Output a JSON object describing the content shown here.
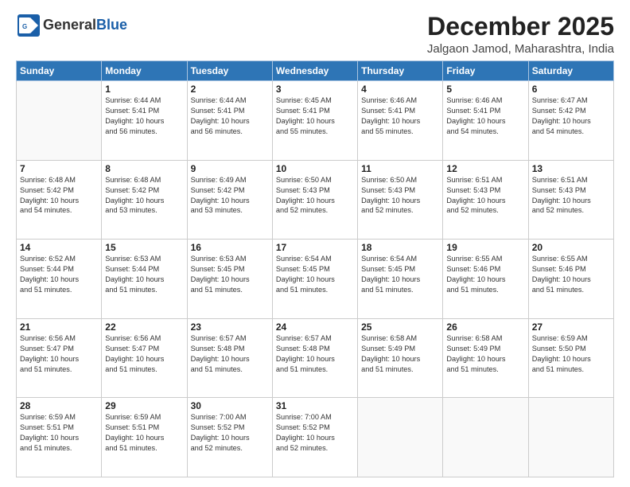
{
  "header": {
    "logo_general": "General",
    "logo_blue": "Blue",
    "month": "December 2025",
    "location": "Jalgaon Jamod, Maharashtra, India"
  },
  "weekdays": [
    "Sunday",
    "Monday",
    "Tuesday",
    "Wednesday",
    "Thursday",
    "Friday",
    "Saturday"
  ],
  "weeks": [
    [
      {
        "day": "",
        "info": ""
      },
      {
        "day": "1",
        "info": "Sunrise: 6:44 AM\nSunset: 5:41 PM\nDaylight: 10 hours\nand 56 minutes."
      },
      {
        "day": "2",
        "info": "Sunrise: 6:44 AM\nSunset: 5:41 PM\nDaylight: 10 hours\nand 56 minutes."
      },
      {
        "day": "3",
        "info": "Sunrise: 6:45 AM\nSunset: 5:41 PM\nDaylight: 10 hours\nand 55 minutes."
      },
      {
        "day": "4",
        "info": "Sunrise: 6:46 AM\nSunset: 5:41 PM\nDaylight: 10 hours\nand 55 minutes."
      },
      {
        "day": "5",
        "info": "Sunrise: 6:46 AM\nSunset: 5:41 PM\nDaylight: 10 hours\nand 54 minutes."
      },
      {
        "day": "6",
        "info": "Sunrise: 6:47 AM\nSunset: 5:42 PM\nDaylight: 10 hours\nand 54 minutes."
      }
    ],
    [
      {
        "day": "7",
        "info": "Sunrise: 6:48 AM\nSunset: 5:42 PM\nDaylight: 10 hours\nand 54 minutes."
      },
      {
        "day": "8",
        "info": "Sunrise: 6:48 AM\nSunset: 5:42 PM\nDaylight: 10 hours\nand 53 minutes."
      },
      {
        "day": "9",
        "info": "Sunrise: 6:49 AM\nSunset: 5:42 PM\nDaylight: 10 hours\nand 53 minutes."
      },
      {
        "day": "10",
        "info": "Sunrise: 6:50 AM\nSunset: 5:43 PM\nDaylight: 10 hours\nand 52 minutes."
      },
      {
        "day": "11",
        "info": "Sunrise: 6:50 AM\nSunset: 5:43 PM\nDaylight: 10 hours\nand 52 minutes."
      },
      {
        "day": "12",
        "info": "Sunrise: 6:51 AM\nSunset: 5:43 PM\nDaylight: 10 hours\nand 52 minutes."
      },
      {
        "day": "13",
        "info": "Sunrise: 6:51 AM\nSunset: 5:43 PM\nDaylight: 10 hours\nand 52 minutes."
      }
    ],
    [
      {
        "day": "14",
        "info": "Sunrise: 6:52 AM\nSunset: 5:44 PM\nDaylight: 10 hours\nand 51 minutes."
      },
      {
        "day": "15",
        "info": "Sunrise: 6:53 AM\nSunset: 5:44 PM\nDaylight: 10 hours\nand 51 minutes."
      },
      {
        "day": "16",
        "info": "Sunrise: 6:53 AM\nSunset: 5:45 PM\nDaylight: 10 hours\nand 51 minutes."
      },
      {
        "day": "17",
        "info": "Sunrise: 6:54 AM\nSunset: 5:45 PM\nDaylight: 10 hours\nand 51 minutes."
      },
      {
        "day": "18",
        "info": "Sunrise: 6:54 AM\nSunset: 5:45 PM\nDaylight: 10 hours\nand 51 minutes."
      },
      {
        "day": "19",
        "info": "Sunrise: 6:55 AM\nSunset: 5:46 PM\nDaylight: 10 hours\nand 51 minutes."
      },
      {
        "day": "20",
        "info": "Sunrise: 6:55 AM\nSunset: 5:46 PM\nDaylight: 10 hours\nand 51 minutes."
      }
    ],
    [
      {
        "day": "21",
        "info": "Sunrise: 6:56 AM\nSunset: 5:47 PM\nDaylight: 10 hours\nand 51 minutes."
      },
      {
        "day": "22",
        "info": "Sunrise: 6:56 AM\nSunset: 5:47 PM\nDaylight: 10 hours\nand 51 minutes."
      },
      {
        "day": "23",
        "info": "Sunrise: 6:57 AM\nSunset: 5:48 PM\nDaylight: 10 hours\nand 51 minutes."
      },
      {
        "day": "24",
        "info": "Sunrise: 6:57 AM\nSunset: 5:48 PM\nDaylight: 10 hours\nand 51 minutes."
      },
      {
        "day": "25",
        "info": "Sunrise: 6:58 AM\nSunset: 5:49 PM\nDaylight: 10 hours\nand 51 minutes."
      },
      {
        "day": "26",
        "info": "Sunrise: 6:58 AM\nSunset: 5:49 PM\nDaylight: 10 hours\nand 51 minutes."
      },
      {
        "day": "27",
        "info": "Sunrise: 6:59 AM\nSunset: 5:50 PM\nDaylight: 10 hours\nand 51 minutes."
      }
    ],
    [
      {
        "day": "28",
        "info": "Sunrise: 6:59 AM\nSunset: 5:51 PM\nDaylight: 10 hours\nand 51 minutes."
      },
      {
        "day": "29",
        "info": "Sunrise: 6:59 AM\nSunset: 5:51 PM\nDaylight: 10 hours\nand 51 minutes."
      },
      {
        "day": "30",
        "info": "Sunrise: 7:00 AM\nSunset: 5:52 PM\nDaylight: 10 hours\nand 52 minutes."
      },
      {
        "day": "31",
        "info": "Sunrise: 7:00 AM\nSunset: 5:52 PM\nDaylight: 10 hours\nand 52 minutes."
      },
      {
        "day": "",
        "info": ""
      },
      {
        "day": "",
        "info": ""
      },
      {
        "day": "",
        "info": ""
      }
    ]
  ]
}
